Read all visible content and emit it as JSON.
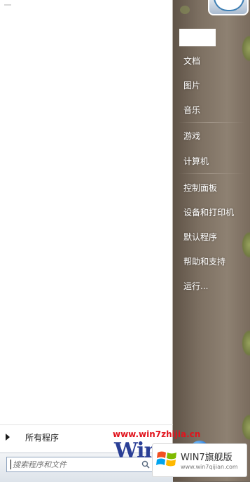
{
  "left_pane": {
    "all_programs_label": "所有程序",
    "search": {
      "placeholder": "搜索程序和文件"
    }
  },
  "right_pane": {
    "items": [
      {
        "label": "文档"
      },
      {
        "label": "图片"
      },
      {
        "label": "音乐"
      },
      {
        "label": "游戏"
      },
      {
        "label": "计算机"
      },
      {
        "label": "控制面板"
      },
      {
        "label": "设备和打印机"
      },
      {
        "label": "默认程序"
      },
      {
        "label": "帮助和支持"
      },
      {
        "label": "运行..."
      }
    ]
  },
  "watermark": {
    "url": "www.win7zhijia.cn",
    "logo_text": "Win",
    "badge_title": "WIN7旗舰版",
    "badge_url": "www.win7qijian.com"
  },
  "colors": {
    "right_pane": "#7d7062",
    "watermark_red": "#e1141d",
    "watermark_blue": "#2a3f96"
  }
}
